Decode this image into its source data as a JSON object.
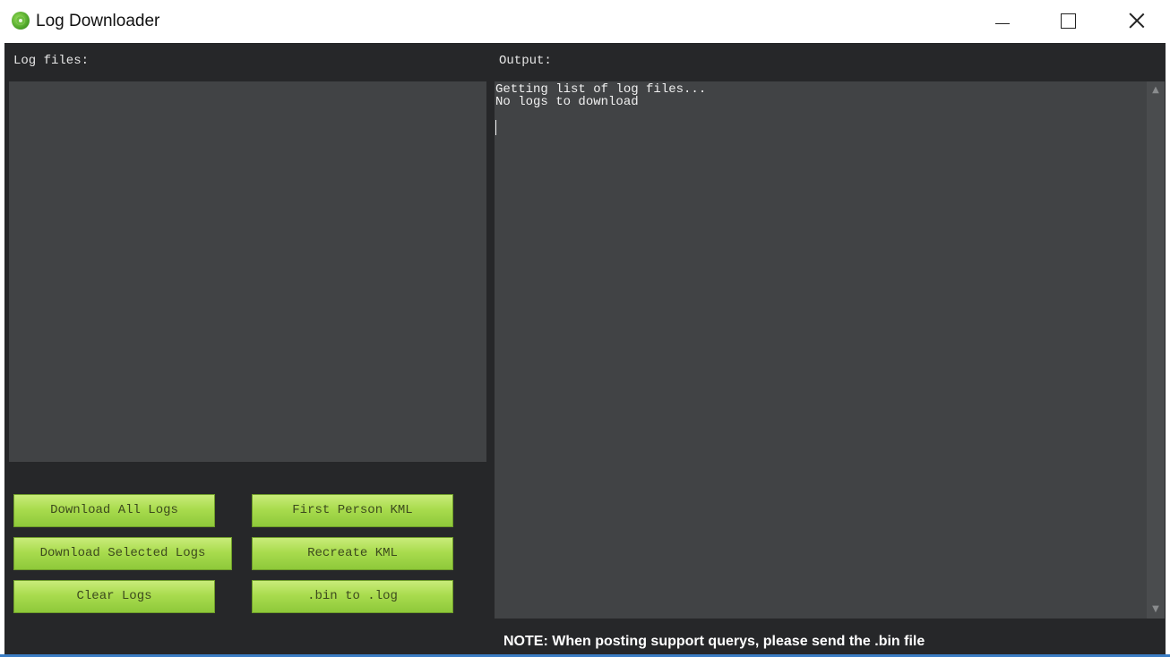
{
  "window": {
    "title": "Log Downloader",
    "icon": "ardupilot-logo-icon"
  },
  "log_panel": {
    "label": "Log files:",
    "items": []
  },
  "output_panel": {
    "label": "Output:",
    "lines": [
      "Getting list of log files...",
      "No logs to download"
    ]
  },
  "buttons": {
    "download_all": "Download All Logs",
    "download_selected": "Download Selected Logs",
    "clear_logs": "Clear Logs",
    "first_person_kml": "First Person KML",
    "recreate_kml": "Recreate KML",
    "bin_to_log": ".bin to .log"
  },
  "note": "NOTE: When posting support querys, please send the .bin file",
  "colors": {
    "background": "#262729",
    "panel": "#414345",
    "button": "#a9dc4e",
    "text": "#e6e6e6"
  }
}
